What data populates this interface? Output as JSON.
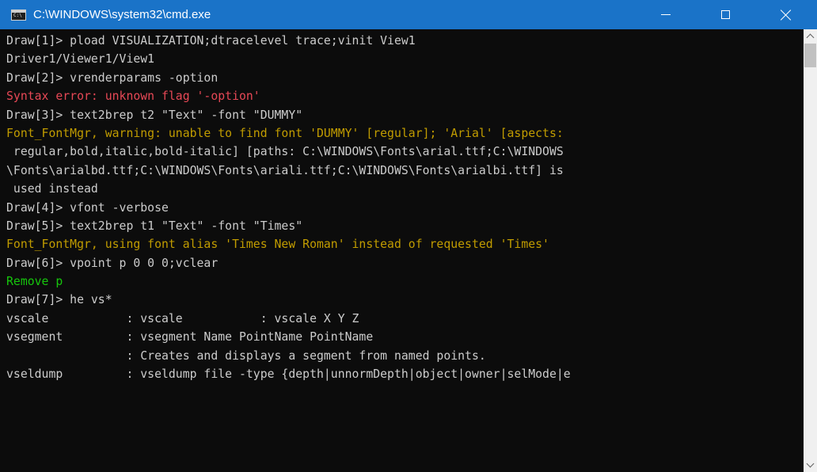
{
  "window": {
    "title": "C:\\WINDOWS\\system32\\cmd.exe",
    "icon_text": "C:\\",
    "title_bar_color": "#1a73c8"
  },
  "console": {
    "lines": [
      {
        "text": "Draw[1]> pload VISUALIZATION;dtracelevel trace;vinit View1",
        "style": "default"
      },
      {
        "text": "Driver1/Viewer1/View1",
        "style": "default"
      },
      {
        "text": "Draw[2]> vrenderparams -option",
        "style": "default"
      },
      {
        "text": "Syntax error: unknown flag '-option'",
        "style": "error"
      },
      {
        "text": "Draw[3]> text2brep t2 \"Text\" -font \"DUMMY\"",
        "style": "default"
      },
      {
        "text": "Font_FontMgr, warning: unable to find font 'DUMMY' [regular]; 'Arial' [aspects:",
        "style": "warning"
      },
      {
        "text": " regular,bold,italic,bold-italic] [paths: C:\\WINDOWS\\Fonts\\arial.ttf;C:\\WINDOWS",
        "style": "default"
      },
      {
        "text": "\\Fonts\\arialbd.ttf;C:\\WINDOWS\\Fonts\\ariali.ttf;C:\\WINDOWS\\Fonts\\arialbi.ttf] is",
        "style": "default"
      },
      {
        "text": " used instead",
        "style": "default"
      },
      {
        "text": "Draw[4]> vfont -verbose",
        "style": "default"
      },
      {
        "text": "Draw[5]> text2brep t1 \"Text\" -font \"Times\"",
        "style": "default"
      },
      {
        "text": "Font_FontMgr, using font alias 'Times New Roman' instead of requested 'Times'",
        "style": "warning"
      },
      {
        "text": "Draw[6]> vpoint p 0 0 0;vclear",
        "style": "default"
      },
      {
        "text": "Remove p",
        "style": "success"
      },
      {
        "text": "Draw[7]> he vs*",
        "style": "default"
      },
      {
        "text": "vscale           : vscale           : vscale X Y Z",
        "style": "default"
      },
      {
        "text": "vsegment         : vsegment Name PointName PointName",
        "style": "default"
      },
      {
        "text": "                 : Creates and displays a segment from named points.",
        "style": "default"
      },
      {
        "text": "vseldump         : vseldump file -type {depth|unnormDepth|object|owner|selMode|e",
        "style": "default"
      }
    ],
    "colors": {
      "default": "#cccccc",
      "error": "#e74856",
      "warning": "#c19c00",
      "success": "#16c60c",
      "background": "#0c0c0c"
    }
  },
  "scrollbar": {
    "up_icon": "chevron-up-icon",
    "down_icon": "chevron-down-icon",
    "position": 0.0
  }
}
